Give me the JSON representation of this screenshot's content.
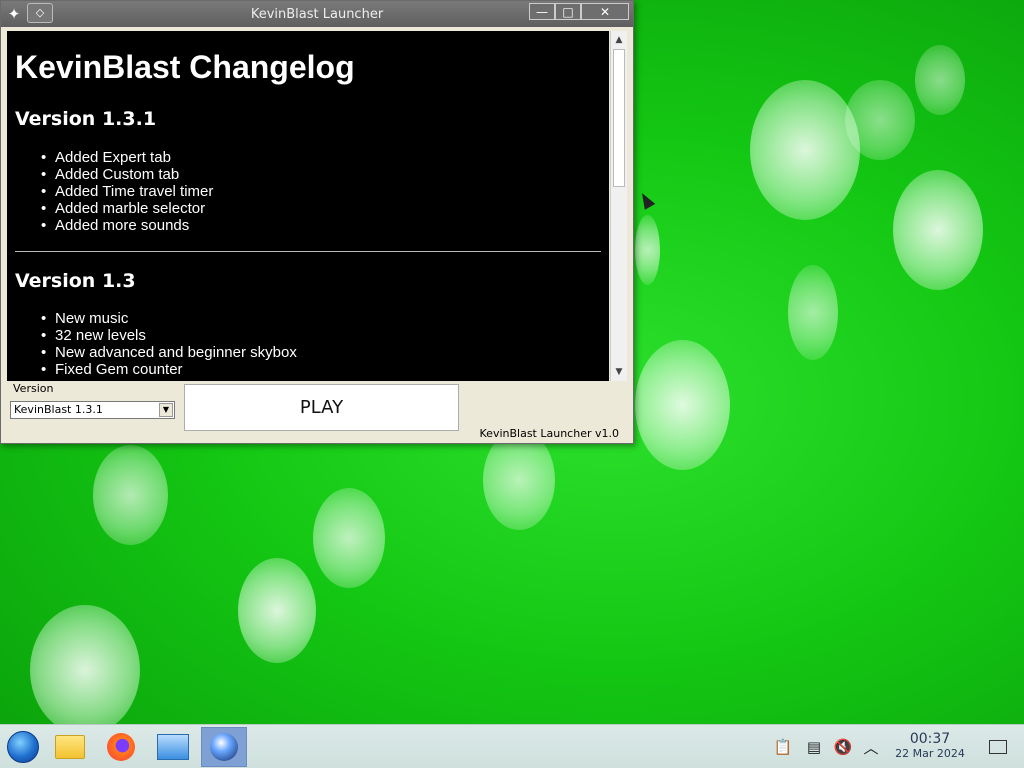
{
  "window": {
    "title": "KevinBlast Launcher",
    "pin_glyph": "◇",
    "app_icon": "kevinblast-icon",
    "buttons": {
      "minimize": "—",
      "maximize": "□",
      "close": "✕"
    }
  },
  "changelog": {
    "heading": "KevinBlast Changelog",
    "sections": [
      {
        "version": "Version 1.3.1",
        "items": [
          "Added Expert tab",
          "Added Custom tab",
          "Added Time travel timer",
          "Added marble selector",
          "Added more sounds"
        ]
      },
      {
        "version": "Version 1.3",
        "items": [
          "New music",
          "32 new levels",
          "New advanced and beginner skybox",
          "Fixed Gem counter"
        ]
      }
    ]
  },
  "controls": {
    "version_label": "Version",
    "version_selected": "KevinBlast 1.3.1",
    "play_label": "PLAY",
    "footer": "KevinBlast Launcher v1.0"
  },
  "taskbar": {
    "items": [
      "start-orb-icon",
      "folder-icon",
      "firefox-icon",
      "system-settings-icon",
      "kevinblast-icon"
    ],
    "active_item": "kevinblast-icon",
    "tray": [
      "clipboard-icon",
      "device-icon",
      "volume-muted-icon",
      "chevron-up-icon"
    ],
    "time": "00:37",
    "date": "22 Mar 2024",
    "show_desktop": "show-desktop-icon"
  },
  "colors": {
    "desktop_green": "#14c814",
    "changelog_bg": "#000000",
    "window_bg": "#ece9d8",
    "taskbar_bg": "#d5e5e2",
    "active_task": "#7fa0d3"
  }
}
